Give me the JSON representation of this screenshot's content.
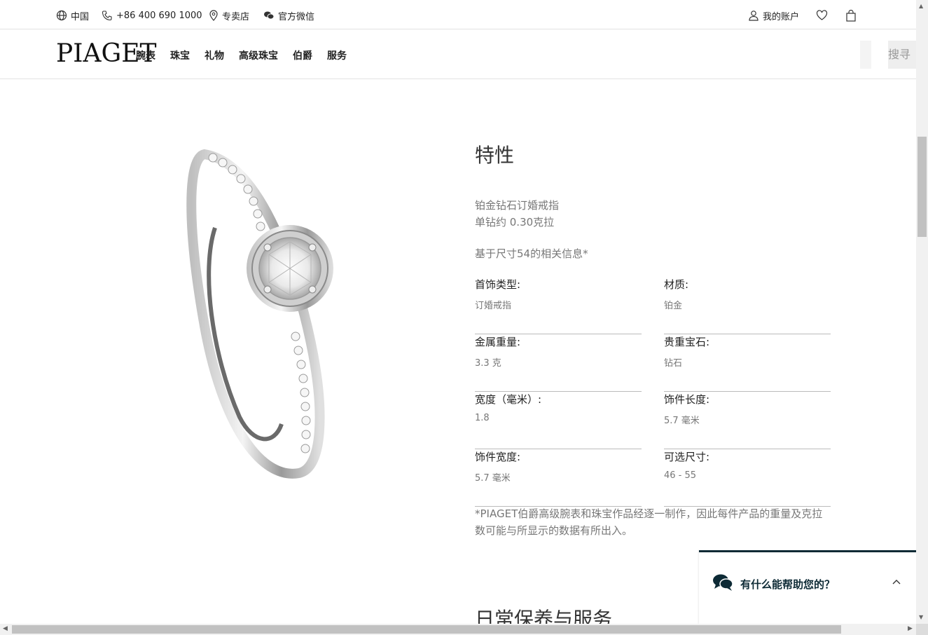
{
  "utility": {
    "region": "中国",
    "phone": "+86 400 690 1000",
    "stores": "专卖店",
    "wechat": "官方微信",
    "account": "我的账户"
  },
  "nav": {
    "logo": "PIAGET",
    "links": [
      "腕表",
      "珠宝",
      "礼物",
      "高级珠宝",
      "伯爵",
      "服务"
    ],
    "search_label": "搜寻"
  },
  "characteristics": {
    "title": "特性",
    "line1": "铂金钻石订婚戒指",
    "line2": "单钻约 0.30克拉",
    "size_info": "基于尺寸54的相关信息*",
    "specs": [
      {
        "label": "首饰类型:",
        "value": "订婚戒指"
      },
      {
        "label": "材质:",
        "value": "铂金"
      },
      {
        "label": "金属重量:",
        "value": "3.3 克"
      },
      {
        "label": "贵重宝石:",
        "value": "钻石"
      },
      {
        "label": "宽度（毫米）:",
        "value": "1.8"
      },
      {
        "label": "饰件长度:",
        "value": "5.7 毫米"
      },
      {
        "label": "饰件宽度:",
        "value": "5.7 毫米"
      },
      {
        "label": "可选尺寸:",
        "value": "46 - 55"
      }
    ],
    "note": "*PIAGET伯爵高级腕表和珠宝作品经逐一制作，因此每件产品的重量及克拉数可能与所显示的数据有所出入。"
  },
  "next_section_title": "日常保养与服务",
  "chat": {
    "title": "有什么能帮助您的？"
  },
  "colors": {
    "chat_accent": "#0d2a35",
    "value_text": "#777777"
  }
}
